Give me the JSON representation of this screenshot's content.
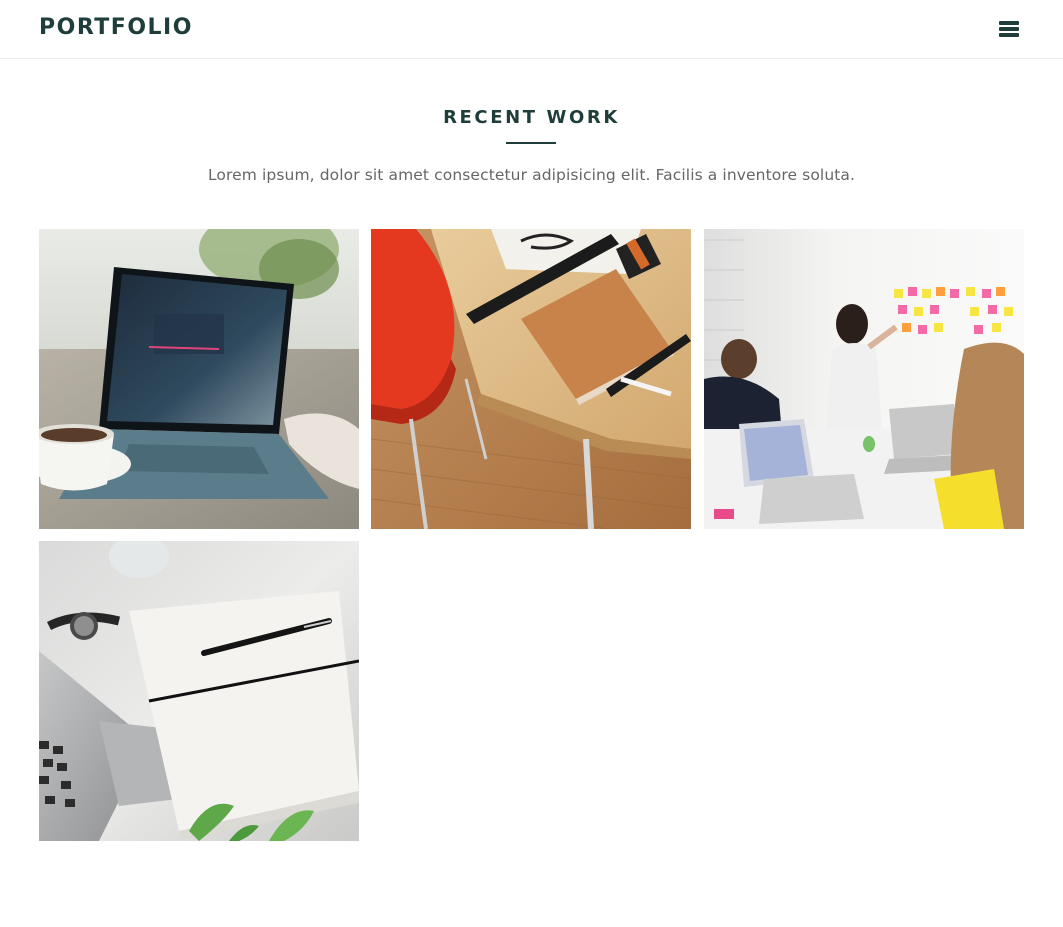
{
  "navbar": {
    "brand": "PORTFOLIO",
    "menu_icon": "hamburger-menu-icon"
  },
  "section": {
    "title": "RECENT WORK",
    "subtitle": "Lorem ipsum, dolor sit amet consectetur adipisicing elit. Facilis a inventore soluta."
  },
  "portfolio_items": [
    {
      "image": "laptop-and-coffee-photo"
    },
    {
      "image": "desk-with-notebook-and-ruler-photo"
    },
    {
      "image": "team-meeting-sticky-notes-photo"
    },
    {
      "image": "notebook-pen-watch-laptop-photo"
    }
  ],
  "colors": {
    "brand": "#1f3d3a",
    "subtitle_text": "#666666",
    "divider": "#ececec"
  }
}
